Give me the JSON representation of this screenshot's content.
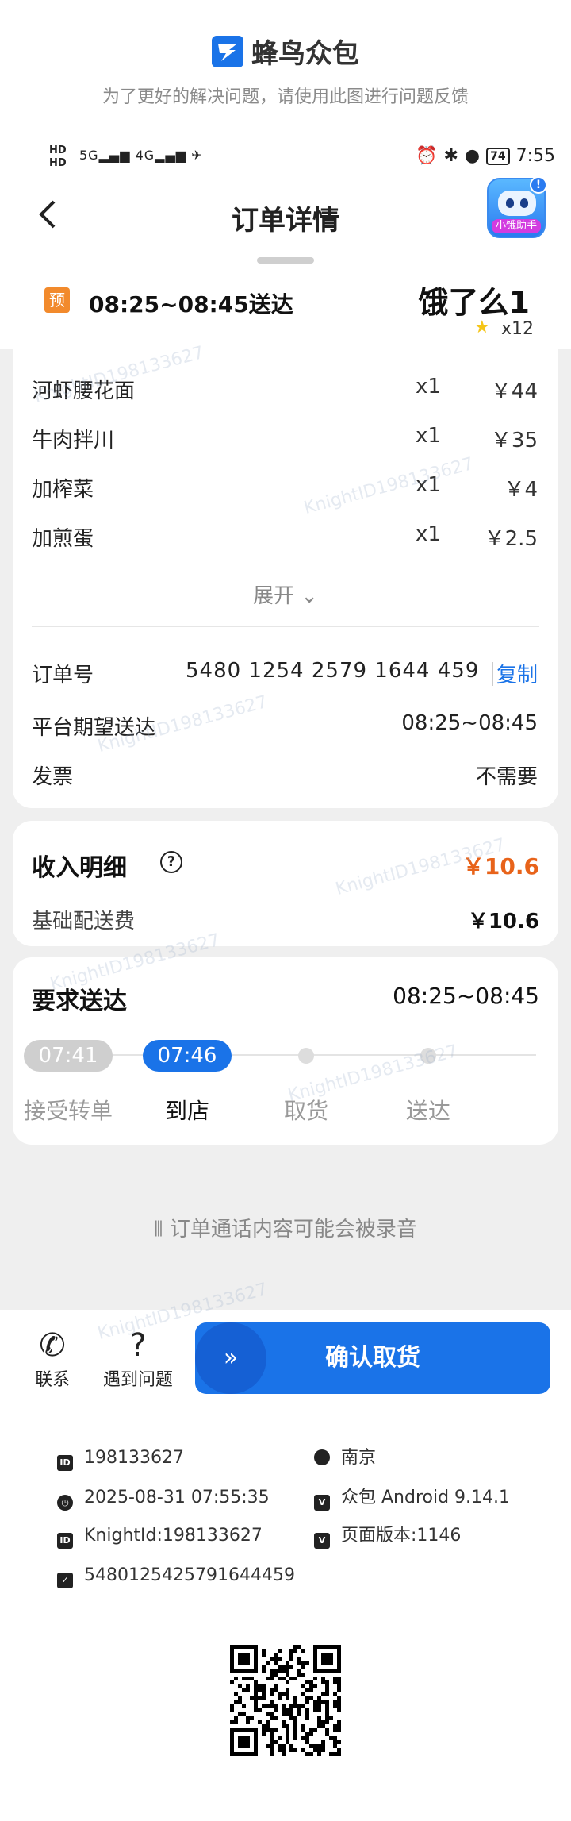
{
  "watermark": {
    "brand_name": "蜂鸟众包",
    "subtitle": "为了更好的解决问题，请使用此图进行问题反馈",
    "repeat_text": "KnightID198133627"
  },
  "status_bar": {
    "sim1": "HD",
    "sim2": "HD",
    "network": "5G",
    "network2": "4G",
    "battery": "74",
    "time": "7:55"
  },
  "header": {
    "title": "订单详情",
    "assistant_label": "小饿助手",
    "assistant_badge": "!"
  },
  "order": {
    "preorder_tag": "预",
    "eta": "08:25~08:45送达",
    "shop_name": "饿了么1",
    "rating_count": "x12",
    "items": [
      {
        "name": "河虾腰花面",
        "qty": "x1",
        "price": "￥44"
      },
      {
        "name": "牛肉拌川",
        "qty": "x1",
        "price": "￥35"
      },
      {
        "name": "加榨菜",
        "qty": "x1",
        "price": "￥4"
      },
      {
        "name": "加煎蛋",
        "qty": "x1",
        "price": "￥2.5"
      }
    ],
    "expand_label": "展开",
    "order_no_label": "订单号",
    "order_no": "5480 1254 2579 1644 459",
    "copy_label": "复制",
    "expected_label": "平台期望送达",
    "expected_value": "08:25~08:45",
    "invoice_label": "发票",
    "invoice_value": "不需要"
  },
  "income": {
    "title": "收入明细",
    "total": "￥10.6",
    "base_label": "基础配送费",
    "base_value": "￥10.6"
  },
  "delivery": {
    "title": "要求送达",
    "time": "08:25~08:45",
    "t1": "07:41",
    "t2": "07:46",
    "steps": [
      "接受转单",
      "到店",
      "取货",
      "送达"
    ]
  },
  "notice": "订单通话内容可能会被录音",
  "actions": {
    "contact": "联系",
    "problem": "遇到问题",
    "confirm": "确认取货"
  },
  "meta": {
    "user_id": "198133627",
    "city": "南京",
    "datetime": "2025-08-31 07:55:35",
    "app_version": "众包 Android 9.14.1",
    "knight_id": "KnightId:198133627",
    "page_version": "页面版本:1146",
    "order_id": "5480125425791644459"
  }
}
